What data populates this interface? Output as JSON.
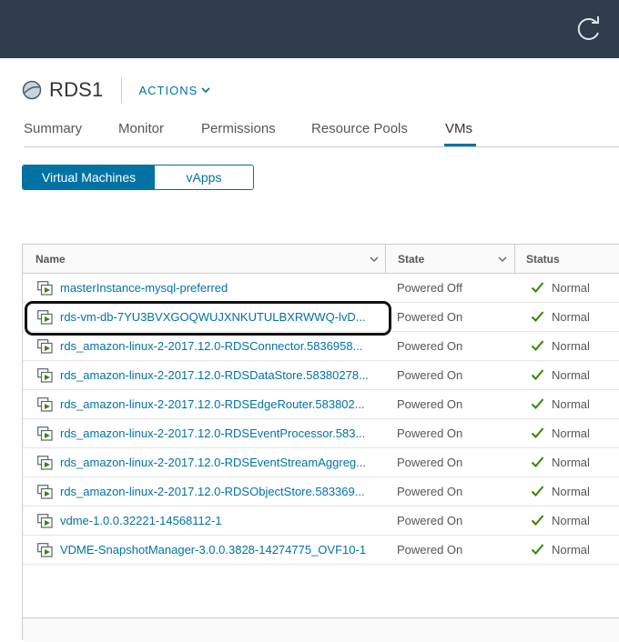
{
  "object": {
    "title": "RDS1",
    "actions_label": "ACTIONS"
  },
  "tabs": [
    "Summary",
    "Monitor",
    "Permissions",
    "Resource Pools",
    "VMs"
  ],
  "segmented": [
    "Virtual Machines",
    "vApps"
  ],
  "table": {
    "columns": [
      "Name",
      "State",
      "Status"
    ],
    "rows": [
      {
        "name": "masterInstance-mysql-preferred",
        "state": "Powered Off",
        "status": "Normal"
      },
      {
        "name": "rds-vm-db-7YU3BVXGOQWUJXNKUTULBXRWWQ-lvD...",
        "state": "Powered On",
        "status": "Normal"
      },
      {
        "name": "rds_amazon-linux-2-2017.12.0-RDSConnector.5836958...",
        "state": "Powered On",
        "status": "Normal"
      },
      {
        "name": "rds_amazon-linux-2-2017.12.0-RDSDataStore.58380278...",
        "state": "Powered On",
        "status": "Normal"
      },
      {
        "name": "rds_amazon-linux-2-2017.12.0-RDSEdgeRouter.583802...",
        "state": "Powered On",
        "status": "Normal"
      },
      {
        "name": "rds_amazon-linux-2-2017.12.0-RDSEventProcessor.583...",
        "state": "Powered On",
        "status": "Normal"
      },
      {
        "name": "rds_amazon-linux-2-2017.12.0-RDSEventStreamAggreg...",
        "state": "Powered On",
        "status": "Normal"
      },
      {
        "name": "rds_amazon-linux-2-2017.12.0-RDSObjectStore.583369...",
        "state": "Powered On",
        "status": "Normal"
      },
      {
        "name": "vdme-1.0.0.32221-14568112-1",
        "state": "Powered On",
        "status": "Normal"
      },
      {
        "name": "VDME-SnapshotManager-3.0.0.3828-14274775_OVF10-1",
        "state": "Powered On",
        "status": "Normal"
      }
    ]
  },
  "colors": {
    "topbar": "#2f3d4c",
    "accent": "#0072a3",
    "status_ok": "#318700"
  }
}
